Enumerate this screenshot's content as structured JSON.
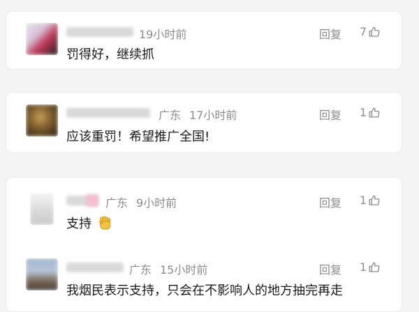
{
  "comments": [
    {
      "location": "",
      "time": "19小时前",
      "reply_label": "回复",
      "likes": "7",
      "text": "罚得好，继续抓"
    },
    {
      "location": "广东",
      "time": "17小时前",
      "reply_label": "回复",
      "likes": "1",
      "text": "应该重罚！希望推广全国!"
    },
    {
      "location": "广东",
      "time": "9小时前",
      "reply_label": "回复",
      "likes": "1",
      "text": "支持"
    },
    {
      "location": "广东",
      "time": "15小时前",
      "reply_label": "回复",
      "likes": "1",
      "text": "我烟民表示支持，只会在不影响人的地方抽完再走"
    }
  ],
  "icons": {
    "like": "thumbs-up-icon",
    "emoji": "raised-fist-emoji"
  },
  "colors": {
    "meta_text": "#8c8c8c",
    "body_text": "#1a1a1a",
    "card_bg": "#ffffff",
    "page_bg": "#f4f4f5"
  }
}
